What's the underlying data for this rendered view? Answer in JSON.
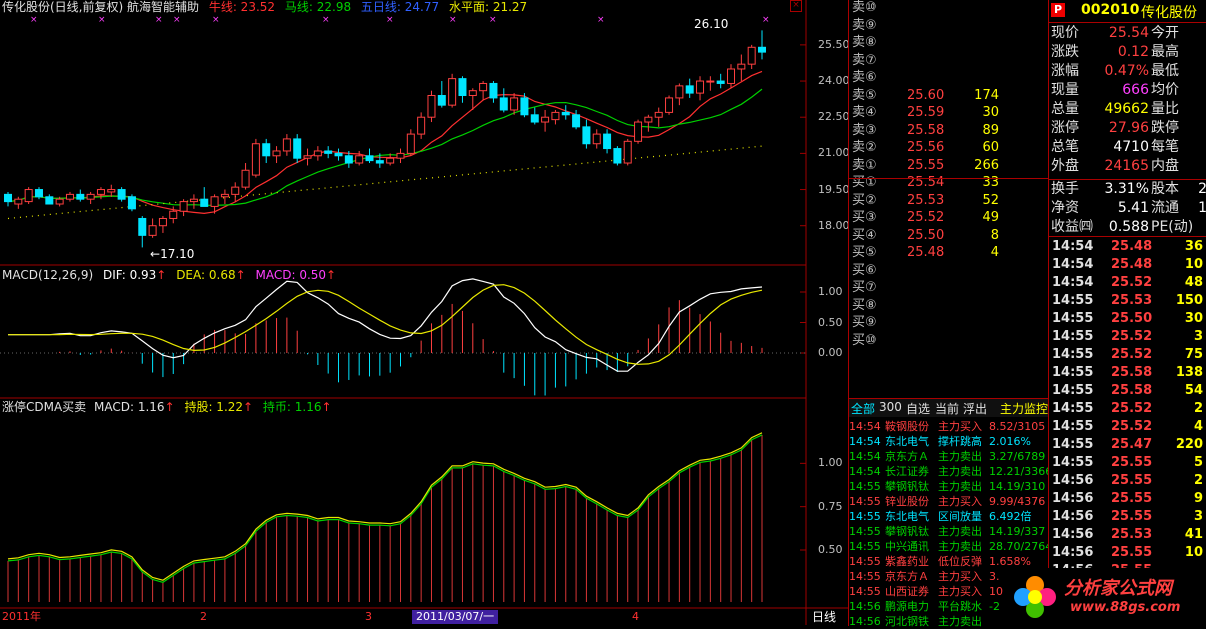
{
  "colors": {
    "up": "#ff4040",
    "down": "#00e5ff",
    "ma_red": "#ff3030",
    "ma_green": "#00d000",
    "ma_yellow": "#e8e800",
    "white": "#ffffff",
    "magenta": "#ff40ff",
    "grid": "#a00000"
  },
  "header": {
    "title": "传化股份(日线,前复权) 航海智能辅助",
    "ma1": "牛线: 23.52",
    "ma2": "马线: 22.98",
    "ma3": "五日线: 24.77",
    "ma4": "水平面: 21.27"
  },
  "price_panel": {
    "ticks": [
      "25.50",
      "24.00",
      "22.50",
      "21.00",
      "19.50",
      "18.00"
    ],
    "high_label": "26.10",
    "low_label": "17.10"
  },
  "macd_panel": {
    "title": "MACD(12,26,9)",
    "dif": "DIF: 0.93",
    "dea": "DEA: 0.68",
    "macd": "MACD: 0.50",
    "ticks": [
      "1.00",
      "0.50",
      "0.00"
    ]
  },
  "cdma_panel": {
    "title": "涨停CDMA买卖",
    "macd": "MACD: 1.16",
    "hold": "持股: 1.22",
    "coin": "持币: 1.16",
    "ticks": [
      "1.00",
      "0.75",
      "0.50"
    ]
  },
  "x_axis": {
    "labels": [
      "2011年",
      "2",
      "3",
      "4"
    ],
    "cursor_date": "2011/03/07/一",
    "period": "日线"
  },
  "chart_data": {
    "type": "candlestick",
    "candles": [
      [
        19.3,
        19.4,
        18.8,
        19.0
      ],
      [
        18.9,
        19.2,
        18.7,
        19.1
      ],
      [
        19.0,
        19.6,
        18.9,
        19.5
      ],
      [
        19.5,
        19.6,
        19.1,
        19.2
      ],
      [
        19.2,
        19.3,
        18.9,
        18.9
      ],
      [
        18.9,
        19.2,
        18.8,
        19.1
      ],
      [
        19.1,
        19.4,
        19.0,
        19.3
      ],
      [
        19.3,
        19.5,
        19.0,
        19.1
      ],
      [
        19.1,
        19.4,
        18.9,
        19.3
      ],
      [
        19.3,
        19.6,
        19.1,
        19.5
      ],
      [
        19.4,
        19.7,
        19.2,
        19.5
      ],
      [
        19.5,
        19.6,
        19.0,
        19.1
      ],
      [
        19.2,
        19.3,
        18.6,
        18.7
      ],
      [
        18.3,
        18.4,
        17.1,
        17.6
      ],
      [
        17.6,
        18.3,
        17.5,
        18.0
      ],
      [
        18.0,
        18.4,
        17.7,
        18.3
      ],
      [
        18.3,
        18.8,
        18.1,
        18.6
      ],
      [
        18.6,
        19.1,
        18.4,
        19.0
      ],
      [
        19.0,
        19.3,
        18.7,
        19.1
      ],
      [
        19.1,
        19.6,
        18.9,
        18.8
      ],
      [
        18.8,
        19.3,
        18.5,
        19.2
      ],
      [
        19.2,
        19.5,
        18.9,
        19.3
      ],
      [
        19.3,
        19.8,
        19.0,
        19.6
      ],
      [
        19.6,
        20.6,
        19.5,
        20.3
      ],
      [
        20.1,
        21.6,
        20.0,
        21.4
      ],
      [
        21.4,
        21.6,
        20.6,
        20.9
      ],
      [
        20.9,
        21.3,
        20.6,
        21.1
      ],
      [
        21.1,
        21.8,
        20.9,
        21.6
      ],
      [
        21.6,
        21.8,
        20.6,
        20.8
      ],
      [
        20.8,
        21.2,
        20.5,
        20.9
      ],
      [
        20.9,
        21.3,
        20.7,
        21.1
      ],
      [
        21.1,
        21.3,
        20.8,
        21.0
      ],
      [
        21.0,
        21.2,
        20.7,
        20.9
      ],
      [
        20.9,
        21.1,
        20.4,
        20.6
      ],
      [
        20.6,
        21.1,
        20.5,
        20.9
      ],
      [
        20.9,
        21.2,
        20.6,
        20.7
      ],
      [
        20.7,
        21.0,
        20.4,
        20.6
      ],
      [
        20.6,
        21.0,
        20.5,
        20.8
      ],
      [
        20.8,
        21.2,
        20.6,
        21.0
      ],
      [
        21.0,
        22.0,
        20.9,
        21.8
      ],
      [
        21.8,
        22.7,
        21.6,
        22.5
      ],
      [
        22.5,
        23.6,
        22.3,
        23.4
      ],
      [
        23.4,
        24.0,
        22.9,
        23.0
      ],
      [
        23.0,
        24.3,
        22.9,
        24.1
      ],
      [
        24.1,
        24.2,
        23.1,
        23.4
      ],
      [
        23.4,
        23.7,
        22.8,
        23.6
      ],
      [
        23.6,
        24.0,
        23.2,
        23.9
      ],
      [
        23.9,
        24.0,
        23.1,
        23.3
      ],
      [
        23.3,
        23.7,
        22.7,
        22.8
      ],
      [
        22.8,
        23.5,
        22.6,
        23.3
      ],
      [
        23.3,
        23.5,
        22.5,
        22.6
      ],
      [
        22.6,
        22.9,
        22.2,
        22.3
      ],
      [
        22.3,
        22.8,
        21.9,
        22.5
      ],
      [
        22.4,
        22.8,
        22.2,
        22.7
      ],
      [
        22.7,
        23.0,
        22.4,
        22.6
      ],
      [
        22.6,
        22.8,
        22.0,
        22.1
      ],
      [
        22.1,
        22.4,
        21.2,
        21.4
      ],
      [
        21.4,
        22.0,
        21.2,
        21.8
      ],
      [
        21.8,
        22.0,
        21.0,
        21.2
      ],
      [
        21.2,
        21.3,
        20.5,
        20.6
      ],
      [
        20.6,
        21.6,
        20.5,
        21.5
      ],
      [
        21.5,
        22.4,
        21.4,
        22.3
      ],
      [
        22.3,
        22.6,
        21.9,
        22.5
      ],
      [
        22.5,
        22.9,
        22.1,
        22.7
      ],
      [
        22.7,
        23.4,
        22.6,
        23.3
      ],
      [
        23.3,
        23.9,
        23.0,
        23.8
      ],
      [
        23.8,
        24.1,
        23.3,
        23.5
      ],
      [
        23.5,
        24.2,
        23.2,
        24.0
      ],
      [
        24.0,
        24.2,
        23.6,
        24.0
      ],
      [
        24.0,
        24.3,
        23.7,
        23.9
      ],
      [
        23.9,
        24.7,
        23.7,
        24.5
      ],
      [
        24.5,
        25.1,
        24.0,
        24.7
      ],
      [
        24.7,
        25.5,
        24.5,
        25.4
      ],
      [
        25.4,
        26.1,
        24.9,
        25.2
      ]
    ],
    "y_range": [
      17.2,
      26.2
    ]
  },
  "orderbook": {
    "sell": [
      {
        "side": "卖⑩",
        "price": "",
        "vol": ""
      },
      {
        "side": "卖⑨",
        "price": "",
        "vol": ""
      },
      {
        "side": "卖⑧",
        "price": "",
        "vol": ""
      },
      {
        "side": "卖⑦",
        "price": "",
        "vol": ""
      },
      {
        "side": "卖⑥",
        "price": "",
        "vol": ""
      },
      {
        "side": "卖⑤",
        "price": "25.60",
        "vol": "174"
      },
      {
        "side": "卖④",
        "price": "25.59",
        "vol": "30"
      },
      {
        "side": "卖③",
        "price": "25.58",
        "vol": "89"
      },
      {
        "side": "卖②",
        "price": "25.56",
        "vol": "60"
      },
      {
        "side": "卖①",
        "price": "25.55",
        "vol": "266"
      }
    ],
    "buy": [
      {
        "side": "买①",
        "price": "25.54",
        "vol": "33"
      },
      {
        "side": "买②",
        "price": "25.53",
        "vol": "52"
      },
      {
        "side": "买③",
        "price": "25.52",
        "vol": "49"
      },
      {
        "side": "买④",
        "price": "25.50",
        "vol": "8"
      },
      {
        "side": "买⑤",
        "price": "25.48",
        "vol": "4"
      },
      {
        "side": "买⑥",
        "price": "",
        "vol": ""
      },
      {
        "side": "买⑦",
        "price": "",
        "vol": ""
      },
      {
        "side": "买⑧",
        "price": "",
        "vol": ""
      },
      {
        "side": "买⑨",
        "price": "",
        "vol": ""
      },
      {
        "side": "买⑩",
        "price": "",
        "vol": ""
      }
    ]
  },
  "monitor": {
    "tabs": [
      "全部",
      "300",
      "自选",
      "当前",
      "浮出",
      "主力监控"
    ],
    "rows": [
      {
        "time": "14:54",
        "name": "鞍钢股份",
        "event": "主力买入",
        "val": "8.52/3105",
        "c": "#ff4040"
      },
      {
        "time": "14:54",
        "name": "东北电气",
        "event": "撑杆跳高",
        "val": "2.016%",
        "c": "#00e5ff"
      },
      {
        "time": "14:54",
        "name": "京东方Ａ",
        "event": "主力卖出",
        "val": "3.27/6789",
        "c": "#00d000"
      },
      {
        "time": "14:54",
        "name": "长江证券",
        "event": "主力卖出",
        "val": "12.21/3366",
        "c": "#00d000"
      },
      {
        "time": "14:55",
        "name": "攀钢钒钛",
        "event": "主力卖出",
        "val": "14.19/310",
        "c": "#00d000"
      },
      {
        "time": "14:55",
        "name": "锌业股份",
        "event": "主力买入",
        "val": "9.99/4376",
        "c": "#ff4040"
      },
      {
        "time": "14:55",
        "name": "东北电气",
        "event": "区间放量",
        "val": "6.492倍",
        "c": "#00e5ff"
      },
      {
        "time": "14:55",
        "name": "攀钢钒钛",
        "event": "主力卖出",
        "val": "14.19/337",
        "c": "#00d000"
      },
      {
        "time": "14:55",
        "name": "中兴通讯",
        "event": "主力卖出",
        "val": "28.70/2764",
        "c": "#00d000"
      },
      {
        "time": "14:55",
        "name": "紫鑫药业",
        "event": "低位反弹",
        "val": "1.658%",
        "c": "#ff4040"
      },
      {
        "time": "14:55",
        "name": "京东方Ａ",
        "event": "主力买入",
        "val": "3.",
        "c": "#ff4040"
      },
      {
        "time": "14:55",
        "name": "山西证券",
        "event": "主力买入",
        "val": "10",
        "c": "#ff4040"
      },
      {
        "time": "14:56",
        "name": "鹏源电力",
        "event": "平台跳水",
        "val": "-2",
        "c": "#00d000"
      },
      {
        "time": "14:56",
        "name": "河北钢铁",
        "event": "主力卖出",
        "val": "",
        "c": "#00d000"
      }
    ]
  },
  "quote": {
    "code": "002010",
    "name": "传化股份",
    "rows": [
      {
        "l": "现价",
        "v": "25.54",
        "r": "今开",
        "rv": "",
        "vc": "#ff4040"
      },
      {
        "l": "涨跌",
        "v": "0.12",
        "r": "最高",
        "rv": "",
        "vc": "#ff4040"
      },
      {
        "l": "涨幅",
        "v": "0.47%",
        "r": "最低",
        "rv": "",
        "vc": "#ff4040"
      },
      {
        "l": "现量",
        "v": "666",
        "r": "均价",
        "rv": "",
        "vc": "#ff40ff"
      },
      {
        "l": "总量",
        "v": "49662",
        "r": "量比",
        "rv": "",
        "vc": "#ffff00"
      },
      {
        "l": "涨停",
        "v": "27.96",
        "r": "跌停",
        "rv": "",
        "vc": "#ff4040"
      },
      {
        "l": "总笔",
        "v": "4710",
        "r": "每笔",
        "rv": "",
        "vc": "#ffffff"
      },
      {
        "l": "外盘",
        "v": "24165",
        "r": "内盘",
        "rv": "",
        "vc": "#ff4040"
      },
      {
        "l": "换手",
        "v": "3.31%",
        "r": "股本",
        "rv": "2",
        "vc": "#ffffff"
      },
      {
        "l": "净资",
        "v": "5.41",
        "r": "流通",
        "rv": "1",
        "vc": "#ffffff"
      },
      {
        "l": "收益㈣",
        "v": "0.588",
        "r": "PE(动)",
        "rv": "",
        "vc": "#ffffff"
      }
    ],
    "ticks": [
      {
        "t": "14:54",
        "p": "25.48",
        "v": "36",
        "pc": "#ff4040",
        "vc": "#ffff00"
      },
      {
        "t": "14:54",
        "p": "25.48",
        "v": "10",
        "pc": "#ff4040",
        "vc": "#ffff00"
      },
      {
        "t": "14:54",
        "p": "25.52",
        "v": "48",
        "pc": "#ff4040",
        "vc": "#ffff00"
      },
      {
        "t": "14:55",
        "p": "25.53",
        "v": "150",
        "pc": "#ff4040",
        "vc": "#ffff00"
      },
      {
        "t": "14:55",
        "p": "25.50",
        "v": "30",
        "pc": "#ff4040",
        "vc": "#ffff00"
      },
      {
        "t": "14:55",
        "p": "25.52",
        "v": "3",
        "pc": "#ff4040",
        "vc": "#ffff00"
      },
      {
        "t": "14:55",
        "p": "25.52",
        "v": "75",
        "pc": "#ff4040",
        "vc": "#ffff00"
      },
      {
        "t": "14:55",
        "p": "25.58",
        "v": "138",
        "pc": "#ff4040",
        "vc": "#ffff00"
      },
      {
        "t": "14:55",
        "p": "25.58",
        "v": "54",
        "pc": "#ff4040",
        "vc": "#ffff00"
      },
      {
        "t": "14:55",
        "p": "25.52",
        "v": "2",
        "pc": "#ff4040",
        "vc": "#ffff00"
      },
      {
        "t": "14:55",
        "p": "25.52",
        "v": "4",
        "pc": "#ff4040",
        "vc": "#ffff00"
      },
      {
        "t": "14:55",
        "p": "25.47",
        "v": "220",
        "pc": "#ff4040",
        "vc": "#ffff00"
      },
      {
        "t": "14:55",
        "p": "25.55",
        "v": "5",
        "pc": "#ff4040",
        "vc": "#ffff00"
      },
      {
        "t": "14:56",
        "p": "25.55",
        "v": "2",
        "pc": "#ff4040",
        "vc": "#ffff00"
      },
      {
        "t": "14:56",
        "p": "25.55",
        "v": "9",
        "pc": "#ff4040",
        "vc": "#ffff00"
      },
      {
        "t": "14:56",
        "p": "25.55",
        "v": "3",
        "pc": "#ff4040",
        "vc": "#ffff00"
      },
      {
        "t": "14:56",
        "p": "25.53",
        "v": "41",
        "pc": "#ff4040",
        "vc": "#ffff00"
      },
      {
        "t": "14:56",
        "p": "25.55",
        "v": "10",
        "pc": "#ff4040",
        "vc": "#ffff00"
      },
      {
        "t": "14:56",
        "p": "25.55",
        "v": "",
        "pc": "#ff4040",
        "vc": "#ffff00"
      }
    ]
  },
  "watermark": {
    "brand": "分析家公式网",
    "url": "www.88gs.com"
  }
}
